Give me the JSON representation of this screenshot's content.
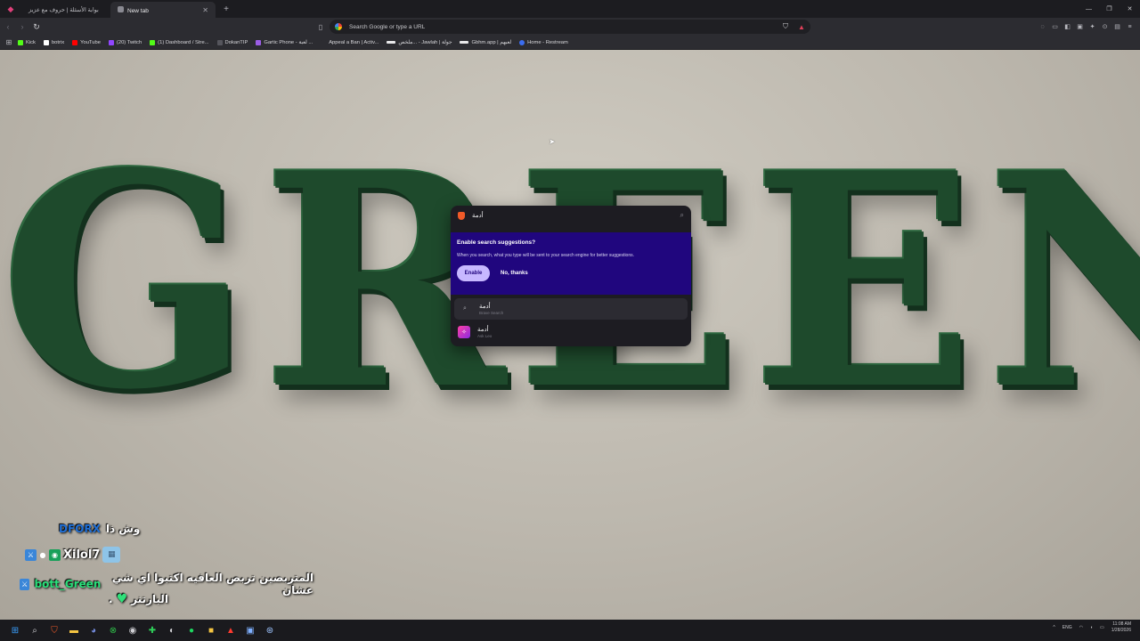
{
  "tabs": [
    {
      "label": "بوابة الأسئلة | حروف مع عزيز",
      "active": false
    },
    {
      "label": "New tab",
      "active": true
    }
  ],
  "toolbar": {
    "address_placeholder": "Search Google or type a URL"
  },
  "bookmarks": [
    {
      "label": "Kick",
      "color": "#53fc18"
    },
    {
      "label": "botrix",
      "color": "#ffffff"
    },
    {
      "label": "YouTube",
      "color": "#ff0000"
    },
    {
      "label": "(20) Twitch",
      "color": "#9146ff"
    },
    {
      "label": "(1) Dashboard / Stre...",
      "color": "#53fc18"
    },
    {
      "label": "DokanTIP",
      "color": "#3a3a40"
    },
    {
      "label": "Gartic Phone - لعبة ...",
      "color": "#9b5de5"
    },
    {
      "label": "Appeal a Ban | Activ...",
      "color": "#2c2c31"
    },
    {
      "label": "ملخص... - Jawlah | جولة",
      "color": "#2c2c31"
    },
    {
      "label": "Gbhm.app | لعبهم",
      "color": "#2c2c31"
    },
    {
      "label": "Home - Restream",
      "color": "#3b6df0"
    }
  ],
  "wallpaper": {
    "word": "GREEN",
    "color": "#1e4a2c"
  },
  "search_popup": {
    "query": "أدمة",
    "promo_title": "Enable search suggestions?",
    "promo_text": "When you search, what you type will be sent to your search engine for better suggestions.",
    "enable_label": "Enable",
    "no_thanks_label": "No, thanks",
    "suggestions": [
      {
        "text": "أدمة",
        "source": "Brave Search"
      },
      {
        "text": "أدمة",
        "source": "Ask Leo"
      }
    ]
  },
  "chat": [
    {
      "user": "DFORX",
      "message": "وش ذا"
    },
    {
      "user": "Xilol7",
      "message": ""
    },
    {
      "user": "bott_Green",
      "message": "المتربصين تربص العافيه اكتبوا اي شي عشان"
    },
    {
      "user": "",
      "message": "البارتنر"
    }
  ],
  "taskbar": {
    "time": "11:08 AM",
    "date": "1/28/2026",
    "lang": "ENG"
  }
}
